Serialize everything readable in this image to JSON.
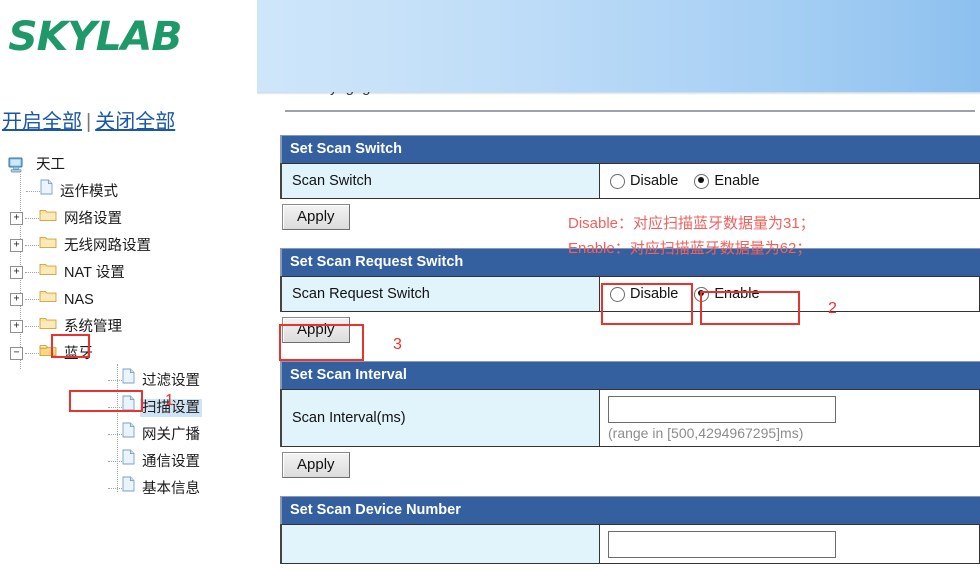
{
  "brand": {
    "logo_text": "SKYLAB"
  },
  "banner_links": {
    "enable_all": "开启全部",
    "separator": "|",
    "disable_all": "关闭全部"
  },
  "tree": {
    "root": {
      "label": "天工",
      "icon": "computer-icon"
    },
    "items": [
      {
        "label": "运作模式",
        "icon": "document-icon",
        "expander": "",
        "level": 1,
        "selected": false
      },
      {
        "label": "网络设置",
        "icon": "folder-icon",
        "expander": "+",
        "level": 0,
        "selected": false
      },
      {
        "label": "无线网路设置",
        "icon": "folder-icon",
        "expander": "+",
        "level": 0,
        "selected": false
      },
      {
        "label": "NAT 设置",
        "icon": "folder-icon",
        "expander": "+",
        "level": 0,
        "selected": false
      },
      {
        "label": "NAS",
        "icon": "folder-icon",
        "expander": "+",
        "level": 0,
        "selected": false
      },
      {
        "label": "系统管理",
        "icon": "folder-icon",
        "expander": "+",
        "level": 0,
        "selected": false
      },
      {
        "label": "蓝牙",
        "icon": "folder-open-icon",
        "expander": "−",
        "level": 0,
        "selected": false
      },
      {
        "label": "过滤设置",
        "icon": "document-icon",
        "expander": "",
        "level": 2,
        "selected": false
      },
      {
        "label": "扫描设置",
        "icon": "document-icon",
        "expander": "",
        "level": 2,
        "selected": true
      },
      {
        "label": "网关广播",
        "icon": "document-icon",
        "expander": "",
        "level": 2,
        "selected": false
      },
      {
        "label": "通信设置",
        "icon": "document-icon",
        "expander": "",
        "level": 2,
        "selected": false
      },
      {
        "label": "基本信息",
        "icon": "document-icon",
        "expander": "",
        "level": 2,
        "selected": false
      }
    ]
  },
  "sections": {
    "scan_switch": {
      "title": "Set Scan Switch",
      "label": "Scan Switch",
      "options": [
        {
          "label": "Disable",
          "checked": false
        },
        {
          "label": "Enable",
          "checked": true
        }
      ],
      "apply_label": "Apply"
    },
    "scan_request_switch": {
      "title": "Set Scan Request Switch",
      "label": "Scan Request Switch",
      "options": [
        {
          "label": "Disable",
          "checked": false
        },
        {
          "label": "Enable",
          "checked": true
        }
      ],
      "apply_label": "Apply"
    },
    "scan_interval": {
      "title": "Set Scan Interval",
      "label": "Scan Interval(ms)",
      "value": "",
      "hint": "(range in [500,4294967295]ms)",
      "apply_label": "Apply"
    },
    "scan_device_number": {
      "title": "Set Scan Device Number",
      "label": "",
      "value": ""
    }
  },
  "annotations": {
    "red_note_line1": "Disable：对应扫描蓝牙数据量为31；",
    "red_note_line2": "Enable：对应扫描蓝牙数据量为62；",
    "step1": "1",
    "step2": "2",
    "step3": "3"
  },
  "colors": {
    "brand_green": "#1f9969",
    "section_header_blue": "#35609f",
    "label_cell_cyan": "#e2f4fb",
    "annotation_red": "#e8332f",
    "note_red": "#f0615e",
    "link_blue": "#1b57a8",
    "selection_blue": "#cfe3f5"
  }
}
